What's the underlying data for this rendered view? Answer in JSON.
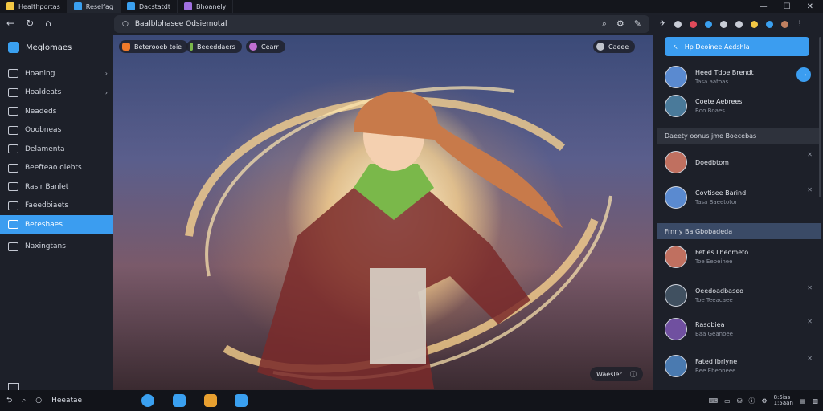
{
  "tabs": [
    {
      "label": "Healthportas",
      "color": "#f2c744"
    },
    {
      "label": "Reselfag",
      "color": "#3aa0f0"
    },
    {
      "label": "Dacstatdt",
      "color": "#3aa0f0"
    },
    {
      "label": "Bhoanely",
      "color": "#a070e0"
    }
  ],
  "window_controls": {
    "min": "—",
    "max": "☐",
    "close": "✕"
  },
  "nav": {
    "back": "←",
    "refresh": "↻",
    "home": "⌂"
  },
  "sidebar": {
    "title": "Meglomaes",
    "items": [
      {
        "label": "Hoaning",
        "chevron": "›"
      },
      {
        "label": "Hoaldeats",
        "chevron": "›"
      },
      {
        "label": "Neadeds",
        "chevron": ""
      },
      {
        "label": "Ooobneas",
        "chevron": ""
      },
      {
        "label": "Delamenta",
        "chevron": ""
      },
      {
        "label": "Beefteao olebts",
        "chevron": ""
      },
      {
        "label": "Rasir Banlet",
        "chevron": ""
      },
      {
        "label": "Faeedbiaets",
        "chevron": ""
      },
      {
        "label": "Beteshaes",
        "chevron": ""
      },
      {
        "label": "Naxingtans",
        "chevron": ""
      }
    ],
    "active_index": 8
  },
  "address": {
    "value": "Baalblohasee Odsiemotal"
  },
  "chips": [
    {
      "label": "Beterooeb toie",
      "color": "#f07a2a"
    },
    {
      "label": "Beeeddaers",
      "color": "#7ab84a"
    },
    {
      "label": "Cearr",
      "color": "#c070d0"
    }
  ],
  "stage_corner_button": {
    "label": "Caeee"
  },
  "stage_float_button": {
    "label": "Waesler"
  },
  "right_panel": {
    "primary": {
      "label": "Hp Deoinee Aedshla"
    },
    "items": [
      {
        "title": "Heed Tdoe Brendt",
        "sub": "Tasa aatoas",
        "color": "#5a8ad0"
      },
      {
        "title": "Coete Aebrees",
        "sub": "Boo Boaes",
        "color": "#4a7a9a"
      }
    ],
    "sections": [
      {
        "label": "Daeety oonus jme Boecebas"
      },
      {
        "label": "Frnrly Ba Gbobadeda"
      }
    ],
    "items2": [
      {
        "title": "Doedbtom",
        "sub": "",
        "color": "#c07060"
      },
      {
        "title": "Covtisee Barind",
        "sub": "Tasa Baeetotor",
        "color": "#5a8ad0"
      }
    ],
    "items3": [
      {
        "title": "Feties Lheometo",
        "sub": "Toe Eebeinee",
        "color": "#c07060"
      },
      {
        "title": "Oeedoadbaseo",
        "sub": "Toe Teeacaee",
        "color": "#405060"
      },
      {
        "title": "Rasobiea",
        "sub": "Baa Geanoee",
        "color": "#7050a0"
      },
      {
        "title": "Fated Ibrlyne",
        "sub": "Bee Ebeoneee",
        "color": "#4a7ab0"
      }
    ]
  },
  "taskbar": {
    "search_label": "Heeatae",
    "apps": [
      "#3aa0f0",
      "#3aa0f0",
      "#e8a030",
      "#3aa0f0"
    ],
    "clock": {
      "time": "8:5iss",
      "date": "1:5aan"
    }
  }
}
